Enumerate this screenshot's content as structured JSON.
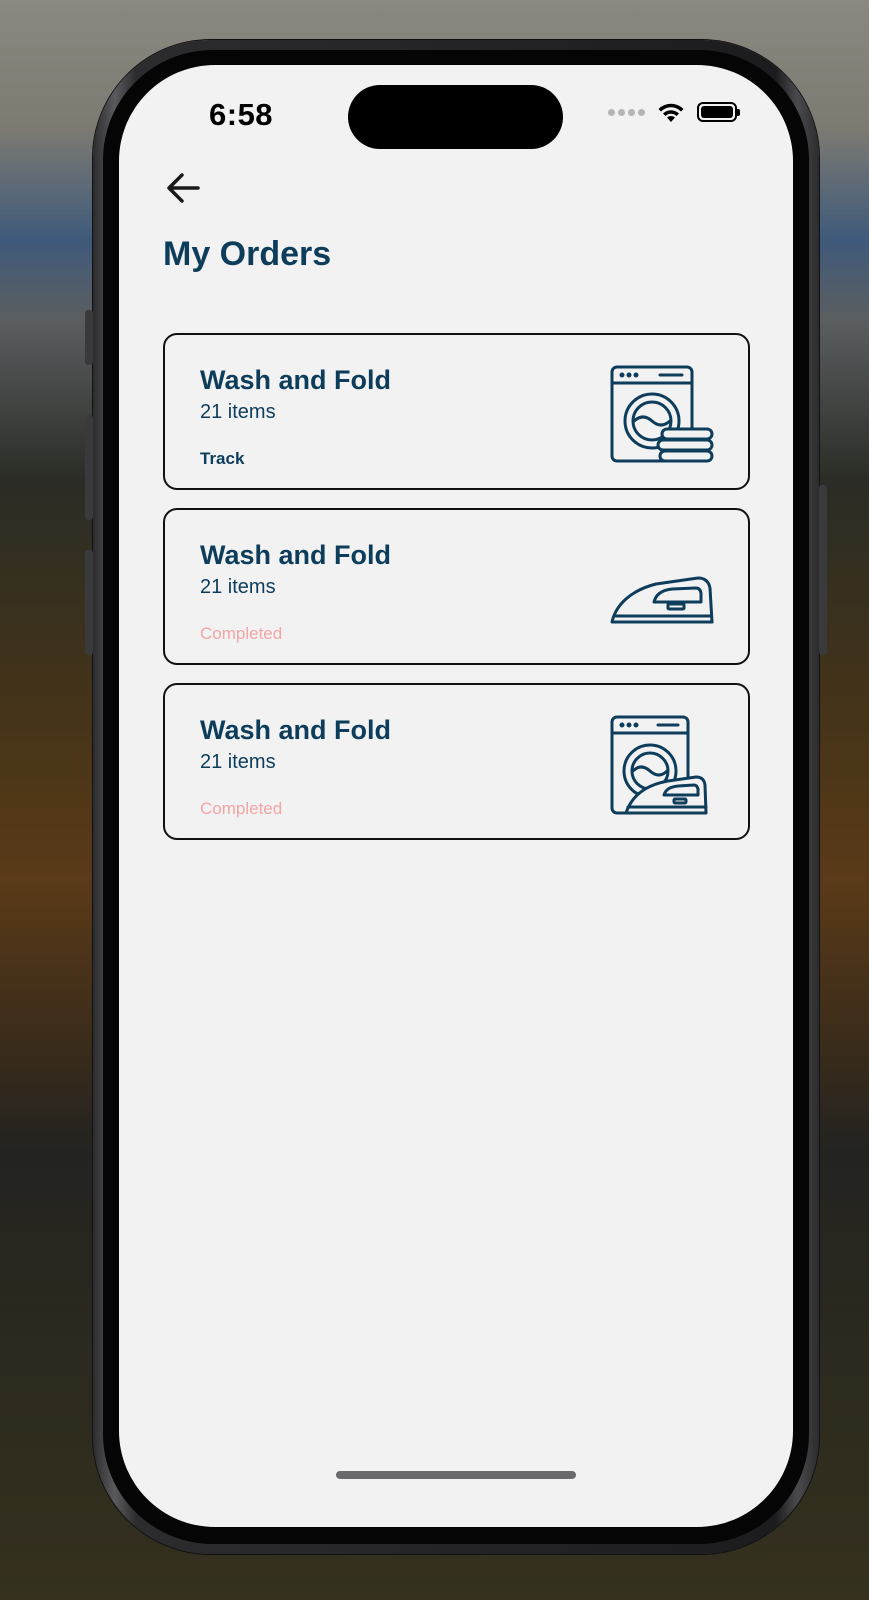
{
  "status_bar": {
    "time": "6:58"
  },
  "header": {
    "back_icon": "arrow-left-icon",
    "title": "My Orders"
  },
  "colors": {
    "primary": "#0d3d5a",
    "completed": "#f2a6a6",
    "background": "#f2f2f3"
  },
  "orders": [
    {
      "title": "Wash and Fold",
      "count": "21 items",
      "status": "Track",
      "icon": "washing-machine-towels-icon"
    },
    {
      "title": "Wash and Fold",
      "count": "21 items",
      "status": "Completed",
      "icon": "iron-icon"
    },
    {
      "title": "Wash and Fold",
      "count": "21 items",
      "status": "Completed",
      "icon": "washing-machine-iron-icon"
    }
  ]
}
